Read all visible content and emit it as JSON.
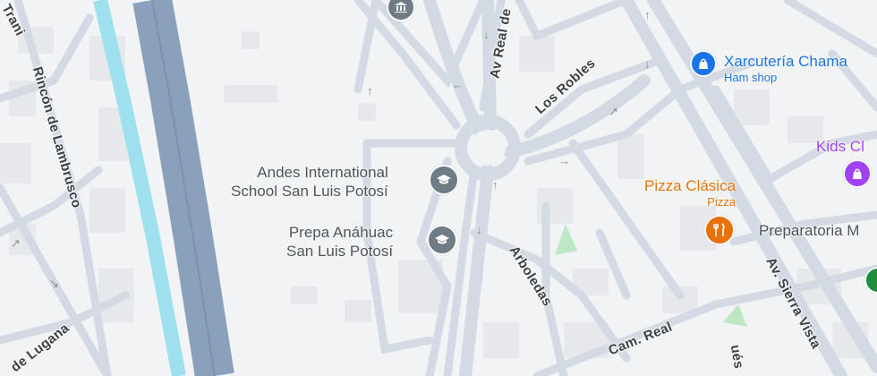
{
  "colors": {
    "land": "#f1f3f4",
    "block": "#e8eaed",
    "road": "#d3dae3",
    "highway": "#8aa0bb",
    "river": "#9fe0ef",
    "park": "#bfe7c5",
    "school": "#6f7b85",
    "shop": "#1a73e8",
    "food": "#e8710a",
    "kids": "#a142f4",
    "street_text": "#3c4043"
  },
  "streets": {
    "rincon": "Rincón de Lambrusco",
    "trani": "Trani",
    "lugana": "de Lugana",
    "av_real": "Av Real de",
    "los_robles": "Los Robles",
    "arboledas": "Arboledas",
    "cam_real": "Cam. Real",
    "sierra_vista": "Av. Sierra Vista",
    "ues": "ués"
  },
  "pois": {
    "andes": {
      "line1": "Andes International",
      "line2": "School San Luis Potosí",
      "icon": "school-icon"
    },
    "anahuac": {
      "line1": "Prepa Anáhuac",
      "line2": "San Luis Potosí",
      "icon": "school-icon"
    },
    "xarcuteria": {
      "name": "Xarcutería Chama",
      "sub": "Ham shop",
      "icon": "shopping-bag-icon"
    },
    "pizza": {
      "name": "Pizza Clásica",
      "sub": "Pizza",
      "icon": "restaurant-icon"
    },
    "kids": {
      "name": "Kids Cl",
      "icon": "shopping-bag-icon"
    },
    "preparatoria": {
      "name": "Preparatoria M",
      "icon": "school-icon"
    }
  }
}
